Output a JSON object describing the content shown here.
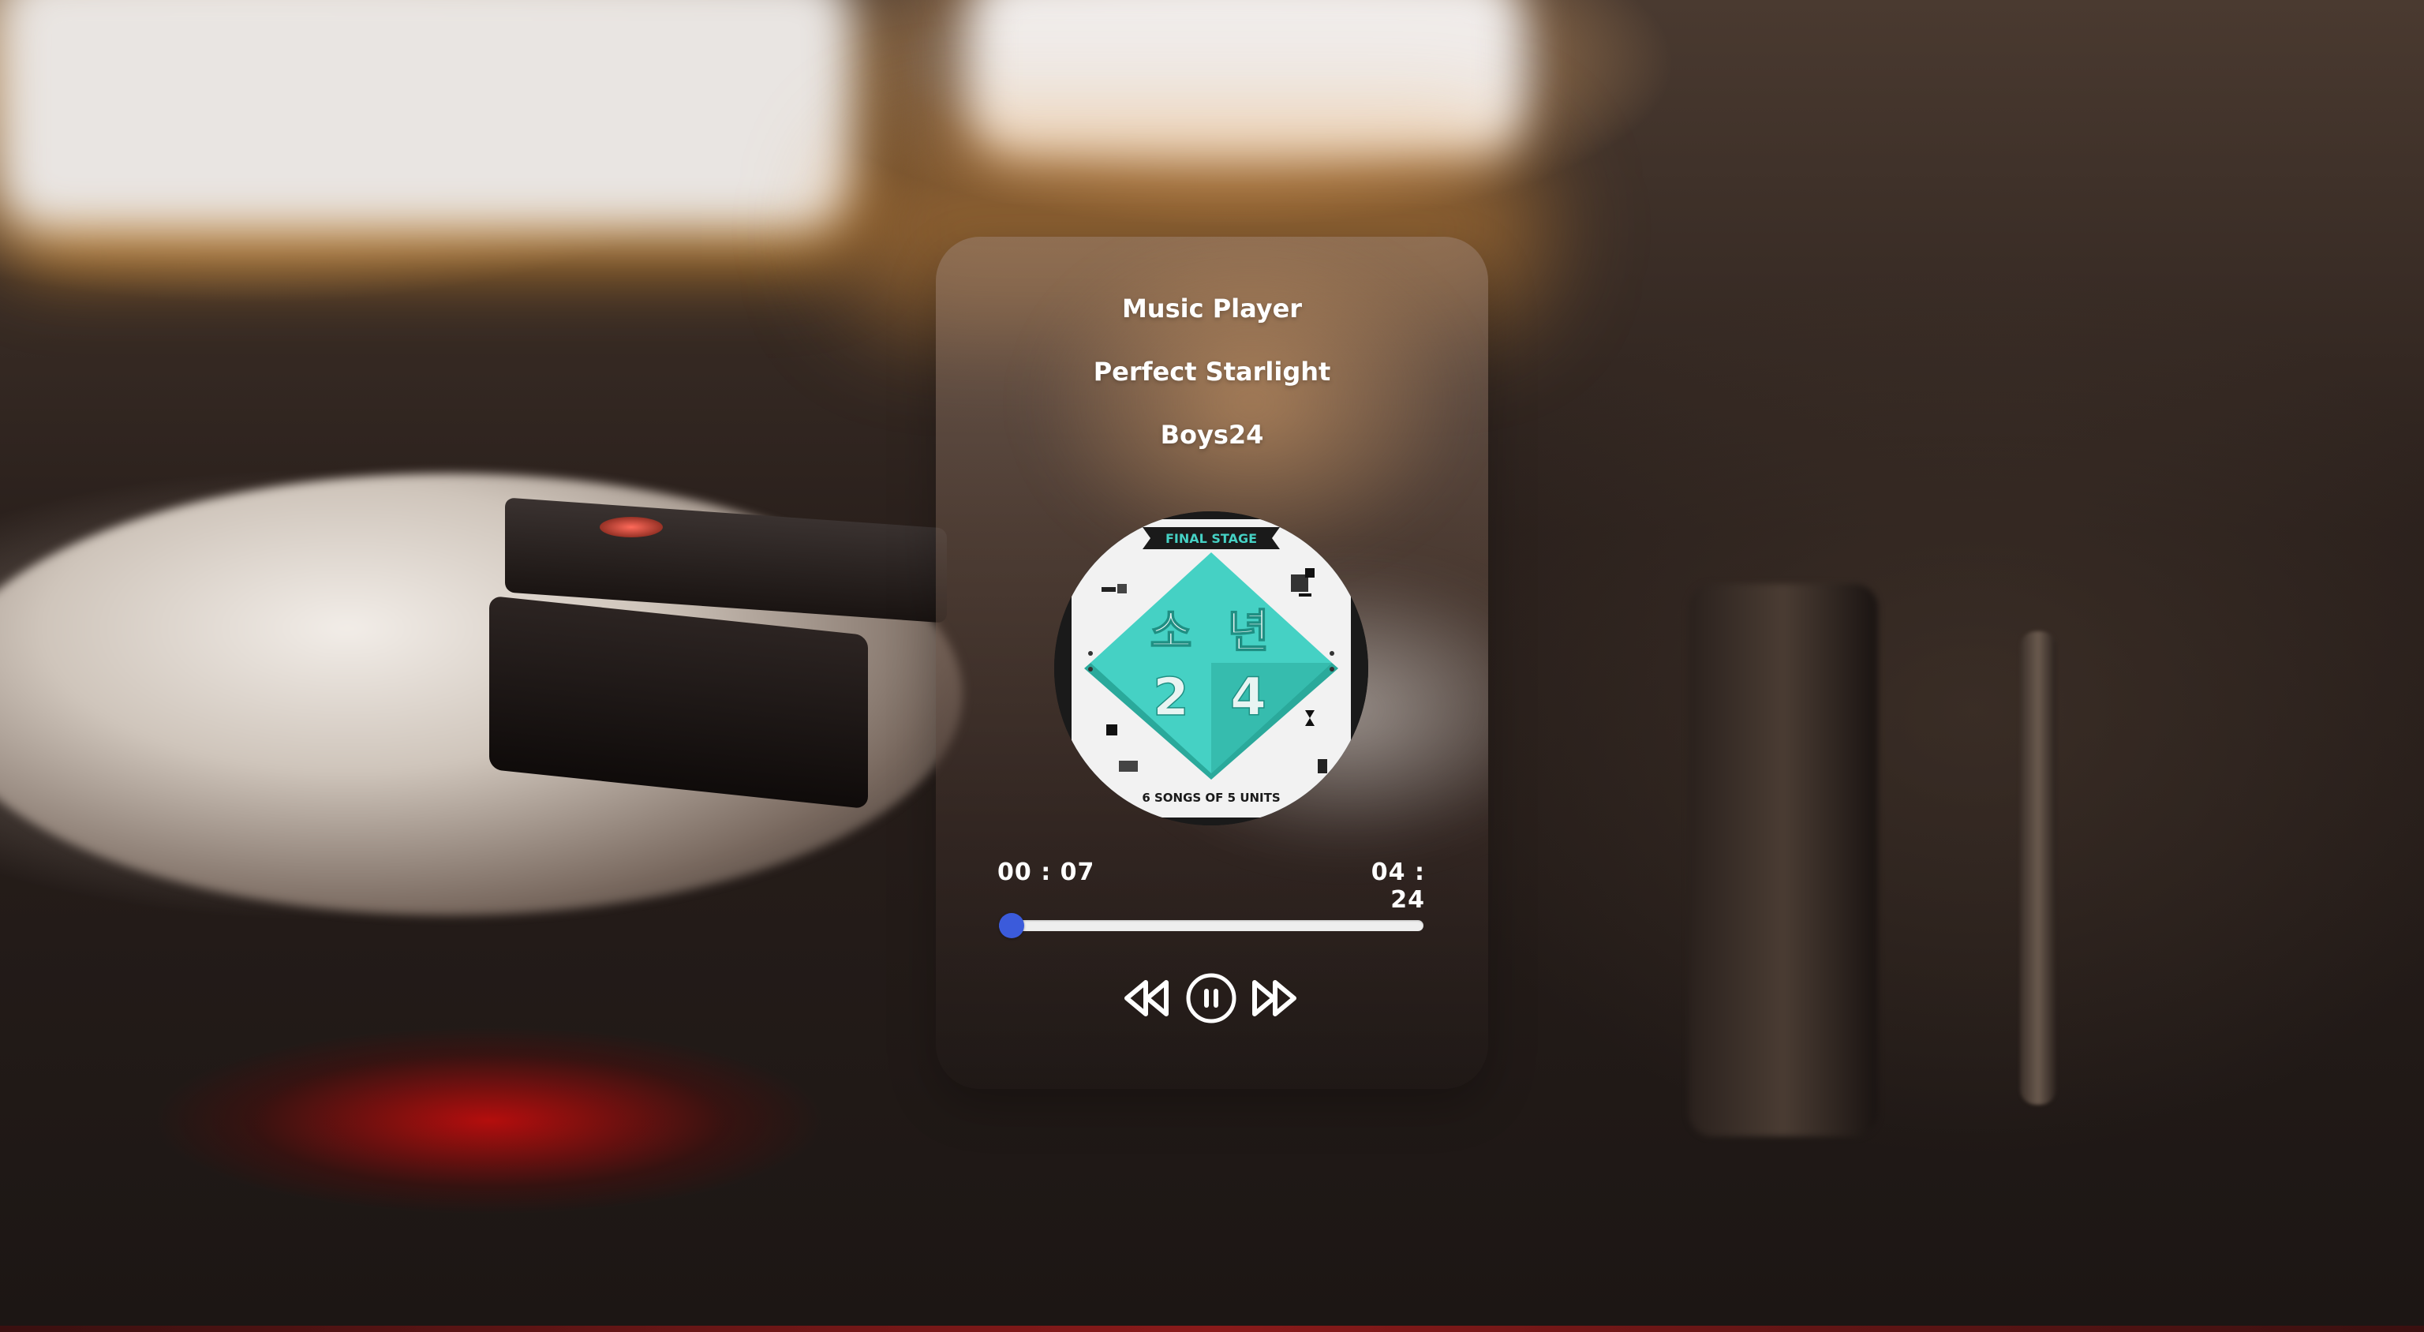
{
  "app": {
    "title": "Music Player"
  },
  "track": {
    "title": "Perfect Starlight",
    "artist": "Boys24",
    "current_time": "00 : 07",
    "total_time": "04 : 24",
    "progress_fraction": 0.027
  },
  "album_art": {
    "top_banner": "FINAL STAGE",
    "center_glyphs": [
      "소",
      "년",
      "2",
      "4"
    ],
    "bottom_caption": "6 SONGS OF 5 UNITS",
    "colors": {
      "teal": "#45d1c4",
      "teal_dark": "#2aa99b",
      "paper": "#f2f2f2",
      "ink": "#1a1a1a"
    }
  },
  "controls": {
    "previous_icon": "rewind-icon",
    "play_pause_icon": "pause-icon",
    "next_icon": "fast-forward-icon"
  },
  "colors": {
    "accent": "#3b5bdb",
    "text": "#ffffff",
    "track": "#eeeeee"
  }
}
